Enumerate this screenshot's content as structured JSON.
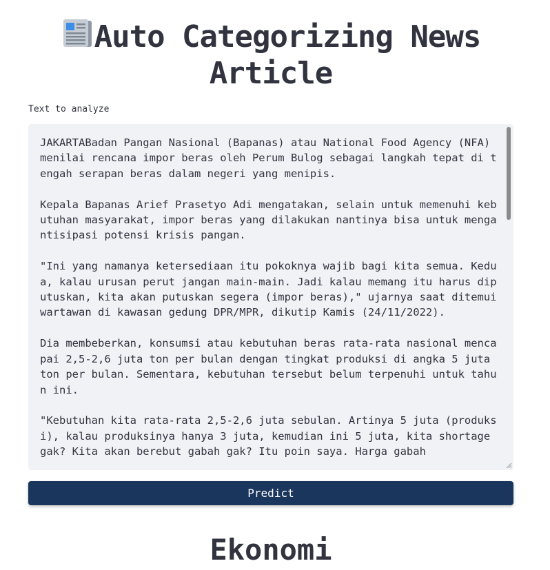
{
  "header": {
    "icon": "newspaper-icon",
    "title_line1": "Auto Categorizing News",
    "title_line2": "Article"
  },
  "input": {
    "label": "Text to analyze",
    "value": "JAKARTABadan Pangan Nasional (Bapanas) atau National Food Agency (NFA) menilai rencana impor beras oleh Perum Bulog sebagai langkah tepat di tengah serapan beras dalam negeri yang menipis.\n\nKepala Bapanas Arief Prasetyo Adi mengatakan, selain untuk memenuhi kebutuhan masyarakat, impor beras yang dilakukan nantinya bisa untuk mengantisipasi potensi krisis pangan.\n\n\"Ini yang namanya ketersediaan itu pokoknya wajib bagi kita semua. Kedua, kalau urusan perut jangan main-main. Jadi kalau memang itu harus diputuskan, kita akan putuskan segera (impor beras),\" ujarnya saat ditemui wartawan di kawasan gedung DPR/MPR, dikutip Kamis (24/11/2022).\n\nDia membeberkan, konsumsi atau kebutuhan beras rata-rata nasional mencapai 2,5-2,6 juta ton per bulan dengan tingkat produksi di angka 5 juta ton per bulan. Sementara, kebutuhan tersebut belum terpenuhi untuk tahun ini.\n\n\"Kebutuhan kita rata-rata 2,5-2,6 juta sebulan. Artinya 5 juta (produksi), kalau produksinya hanya 3 juta, kemudian ini 5 juta, kita shortage gak? Kita akan berebut gabah gak? Itu poin saya. Harga gabah"
  },
  "actions": {
    "predict_label": "Predict"
  },
  "result": {
    "category": "Ekonomi"
  },
  "colors": {
    "button_bg": "#1b365d",
    "textarea_bg": "#f0f2f6",
    "text": "#31333f"
  }
}
